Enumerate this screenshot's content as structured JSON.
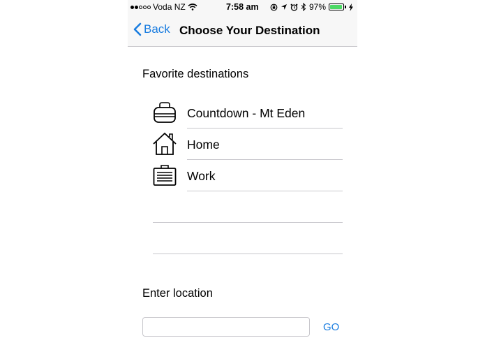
{
  "status_bar": {
    "carrier": "Voda NZ",
    "time": "7:58 am",
    "battery": "97%",
    "battery_level": 0.97
  },
  "nav": {
    "back_label": "Back",
    "title": "Choose Your Destination"
  },
  "favorites": {
    "heading": "Favorite destinations",
    "items": [
      {
        "label": "Countdown - Mt Eden",
        "icon": "shopping-bag-icon"
      },
      {
        "label": "Home",
        "icon": "house-icon"
      },
      {
        "label": "Work",
        "icon": "briefcase-icon"
      }
    ]
  },
  "location": {
    "heading": "Enter location",
    "value": "",
    "placeholder": "",
    "go_label": "GO"
  },
  "colors": {
    "accent": "#1a7de0",
    "battery": "#4cd964"
  }
}
